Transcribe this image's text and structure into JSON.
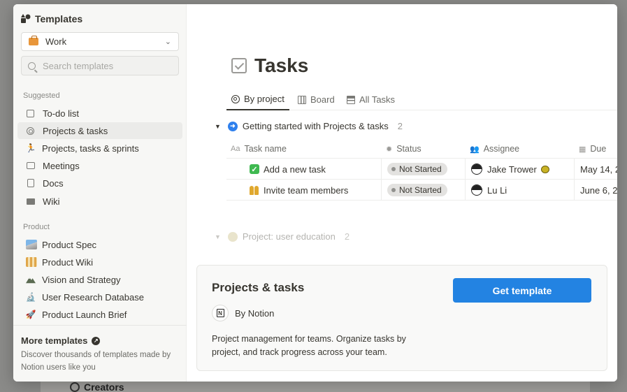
{
  "backdrop": {
    "label": "Creators"
  },
  "sidebar": {
    "title": "Templates",
    "workspace": "Work",
    "search_placeholder": "Search templates",
    "suggested_label": "Suggested",
    "suggested": [
      {
        "label": "To-do list",
        "icon": "checkbox-icon"
      },
      {
        "label": "Projects & tasks",
        "icon": "target-icon",
        "active": true
      },
      {
        "label": "Projects, tasks & sprints",
        "icon": "runner-icon"
      },
      {
        "label": "Meetings",
        "icon": "calendar-icon"
      },
      {
        "label": "Docs",
        "icon": "document-icon"
      },
      {
        "label": "Wiki",
        "icon": "book-icon"
      }
    ],
    "product_label": "Product",
    "product": [
      {
        "label": "Product Spec",
        "icon": "product-spec-icon"
      },
      {
        "label": "Product Wiki",
        "icon": "construction-icon"
      },
      {
        "label": "Vision and Strategy",
        "icon": "mountain-icon"
      },
      {
        "label": "User Research Database",
        "icon": "microscope-icon"
      },
      {
        "label": "Product Launch Brief",
        "icon": "rocket-icon"
      }
    ],
    "more": {
      "title": "More templates",
      "desc": "Discover thousands of templates made by Notion users like you"
    }
  },
  "main": {
    "title": "Tasks",
    "tabs": [
      {
        "label": "By project",
        "active": true
      },
      {
        "label": "Board"
      },
      {
        "label": "All Tasks"
      }
    ],
    "group1": {
      "label": "Getting started with Projects & tasks",
      "count": "2"
    },
    "columns": {
      "aa": "Aa",
      "name": "Task name",
      "status": "Status",
      "assignee": "Assignee",
      "due": "Due"
    },
    "rows": [
      {
        "name": "Add a new task",
        "status": "Not Started",
        "assignee": "Jake Trower",
        "due": "May 14, 2"
      },
      {
        "name": "Invite team members",
        "status": "Not Started",
        "assignee": "Lu Li",
        "due": "June 6, 2"
      }
    ],
    "group2": {
      "label": "Project: user education",
      "count": "2"
    }
  },
  "card": {
    "title": "Projects & tasks",
    "author": "By Notion",
    "description": "Project management for teams. Organize tasks by project, and track progress across your team.",
    "button": "Get template"
  },
  "colors": {
    "accent": "#2383e2",
    "sidebar_bg": "#f7f7f5",
    "status_pill": "#e3e2e0"
  }
}
